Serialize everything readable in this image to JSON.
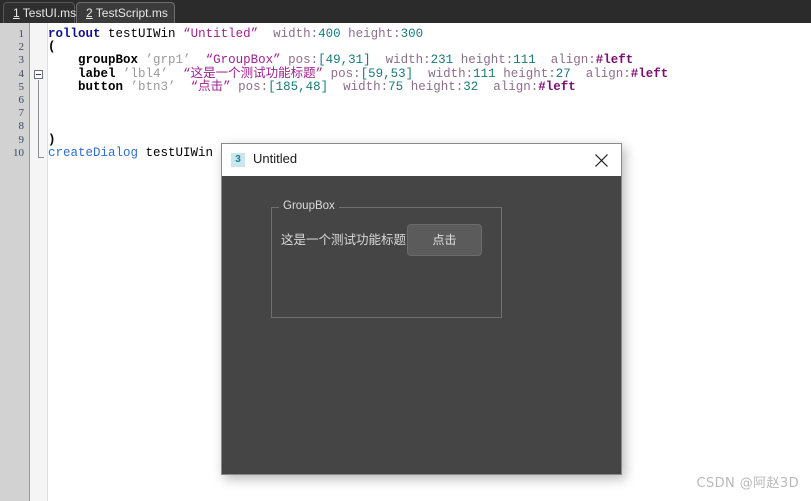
{
  "tabs": [
    {
      "accel": "1",
      "label": " TestUI.ms",
      "active": false
    },
    {
      "accel": "2",
      "label": " TestScript.ms",
      "active": true
    }
  ],
  "editor": {
    "line_numbers": [
      "1",
      "2",
      "3",
      "4",
      "5",
      "6",
      "7",
      "8",
      "9",
      "10"
    ],
    "lines": [
      {
        "n": 1,
        "tokens": [
          {
            "t": "rollout",
            "c": "kw"
          },
          {
            "t": " ",
            "c": "ident"
          },
          {
            "t": "testUIWin",
            "c": "ident"
          },
          {
            "t": " ",
            "c": "ident"
          },
          {
            "t": "“Untitled”",
            "c": "str"
          },
          {
            "t": "  ",
            "c": "ident"
          },
          {
            "t": "width:",
            "c": "prop"
          },
          {
            "t": "400",
            "c": "num"
          },
          {
            "t": " ",
            "c": "ident"
          },
          {
            "t": "height:",
            "c": "prop"
          },
          {
            "t": "300",
            "c": "num"
          }
        ]
      },
      {
        "n": 2,
        "tokens": [
          {
            "t": "(",
            "c": "brk"
          }
        ]
      },
      {
        "n": 3,
        "tokens": [
          {
            "t": "    ",
            "c": "ident"
          },
          {
            "t": "groupBox",
            "c": "ctrl"
          },
          {
            "t": " ",
            "c": "ident"
          },
          {
            "t": "’grp1’",
            "c": "sq"
          },
          {
            "t": "  ",
            "c": "ident"
          },
          {
            "t": "“GroupBox”",
            "c": "str"
          },
          {
            "t": " ",
            "c": "ident"
          },
          {
            "t": "pos:",
            "c": "prop"
          },
          {
            "t": "[49,31]",
            "c": "num"
          },
          {
            "t": "  ",
            "c": "ident"
          },
          {
            "t": "width:",
            "c": "prop"
          },
          {
            "t": "231",
            "c": "num"
          },
          {
            "t": " ",
            "c": "ident"
          },
          {
            "t": "height:",
            "c": "prop"
          },
          {
            "t": "111",
            "c": "num"
          },
          {
            "t": "  ",
            "c": "ident"
          },
          {
            "t": "align:",
            "c": "prop"
          },
          {
            "t": "#left",
            "c": "hash"
          }
        ]
      },
      {
        "n": 4,
        "tokens": [
          {
            "t": "    ",
            "c": "ident"
          },
          {
            "t": "label",
            "c": "ctrl"
          },
          {
            "t": " ",
            "c": "ident"
          },
          {
            "t": "’lbl4’",
            "c": "sq"
          },
          {
            "t": "  ",
            "c": "ident"
          },
          {
            "t": "“这是一个测试功能标题”",
            "c": "str"
          },
          {
            "t": " ",
            "c": "ident"
          },
          {
            "t": "pos:",
            "c": "prop"
          },
          {
            "t": "[59,53]",
            "c": "num"
          },
          {
            "t": "  ",
            "c": "ident"
          },
          {
            "t": "width:",
            "c": "prop"
          },
          {
            "t": "111",
            "c": "num"
          },
          {
            "t": " ",
            "c": "ident"
          },
          {
            "t": "height:",
            "c": "prop"
          },
          {
            "t": "27",
            "c": "num"
          },
          {
            "t": "  ",
            "c": "ident"
          },
          {
            "t": "align:",
            "c": "prop"
          },
          {
            "t": "#left",
            "c": "hash"
          }
        ]
      },
      {
        "n": 5,
        "tokens": [
          {
            "t": "    ",
            "c": "ident"
          },
          {
            "t": "button",
            "c": "ctrl"
          },
          {
            "t": " ",
            "c": "ident"
          },
          {
            "t": "’btn3’",
            "c": "sq"
          },
          {
            "t": "  ",
            "c": "ident"
          },
          {
            "t": "“点击”",
            "c": "str"
          },
          {
            "t": " ",
            "c": "ident"
          },
          {
            "t": "pos:",
            "c": "prop"
          },
          {
            "t": "[185,48]",
            "c": "num"
          },
          {
            "t": "  ",
            "c": "ident"
          },
          {
            "t": "width:",
            "c": "prop"
          },
          {
            "t": "75",
            "c": "num"
          },
          {
            "t": " ",
            "c": "ident"
          },
          {
            "t": "height:",
            "c": "prop"
          },
          {
            "t": "32",
            "c": "num"
          },
          {
            "t": "  ",
            "c": "ident"
          },
          {
            "t": "align:",
            "c": "prop"
          },
          {
            "t": "#left",
            "c": "hash"
          }
        ]
      },
      {
        "n": 6,
        "tokens": []
      },
      {
        "n": 7,
        "tokens": []
      },
      {
        "n": 8,
        "tokens": []
      },
      {
        "n": 9,
        "tokens": [
          {
            "t": ")",
            "c": "brk"
          }
        ]
      },
      {
        "n": 10,
        "tokens": [
          {
            "t": "createDialog",
            "c": "fn"
          },
          {
            "t": " ",
            "c": "ident"
          },
          {
            "t": "testUIWin",
            "c": "ident"
          }
        ]
      }
    ]
  },
  "dialog": {
    "icon_label": "3",
    "title": "Untitled",
    "close_label": "×",
    "groupbox": {
      "title": "GroupBox"
    },
    "label": {
      "text": "这是一个测试功能标题"
    },
    "button": {
      "text": "点击"
    }
  },
  "watermark": "CSDN @阿赵3D",
  "colors": {
    "editor_background": "#ffffff",
    "gutter_background": "#d2d2d2",
    "tabbar_background": "#2b2b2b",
    "dialog_client": "#454545",
    "dialog_titlebar": "#ffffff",
    "button_face": "#5b5b5b",
    "keyword": "#13138f",
    "string": "#a02090",
    "number": "#1a7a7a",
    "property": "#8d6e8d",
    "hash_literal": "#7a1070",
    "function": "#2f6fcf",
    "icon_accent": "#1b7f92"
  }
}
